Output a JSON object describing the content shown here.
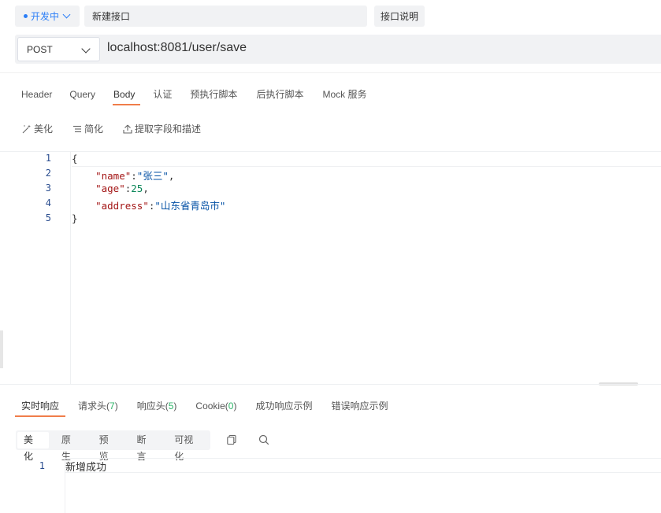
{
  "header": {
    "status_label": "开发中",
    "api_name": "新建接口",
    "doc_button": "接口说明"
  },
  "request": {
    "method": "POST",
    "url": "localhost:8081/user/save"
  },
  "request_tabs": [
    "Header",
    "Query",
    "Body",
    "认证",
    "预执行脚本",
    "后执行脚本",
    "Mock 服务"
  ],
  "active_request_tab": "Body",
  "body_toolbar": {
    "beautify": "美化",
    "simplify": "简化",
    "extract": "提取字段和描述"
  },
  "body_editor": {
    "line_numbers": [
      "1",
      "2",
      "3",
      "4",
      "5"
    ],
    "lines": [
      {
        "open": "{"
      },
      {
        "key": "\"name\"",
        "colon": ":",
        "value": "\"张三\"",
        "tail": ","
      },
      {
        "key": "\"age\"",
        "colon": ":",
        "value": "25",
        "tail": ","
      },
      {
        "key": "\"address\"",
        "colon": ":",
        "value": "\"山东省青岛市\"",
        "tail": ""
      },
      {
        "close": "}"
      }
    ]
  },
  "response_tabs": [
    {
      "label": "实时响应"
    },
    {
      "label": "请求头",
      "count": "7"
    },
    {
      "label": "响应头",
      "count": "5"
    },
    {
      "label": "Cookie",
      "count": "0"
    },
    {
      "label": "成功响应示例"
    },
    {
      "label": "错误响应示例"
    }
  ],
  "response_format_tabs": [
    "美化",
    "原生",
    "预览",
    "断言",
    "可视化"
  ],
  "response_body": {
    "line_numbers": [
      "1"
    ],
    "content": "新增成功"
  },
  "colors": {
    "accent_orange": "#f07d4a",
    "status_blue": "#2b7ef7",
    "count_green": "#2fb56a",
    "json_key": "#a31515",
    "json_string": "#0451a5",
    "json_number": "#098658"
  }
}
